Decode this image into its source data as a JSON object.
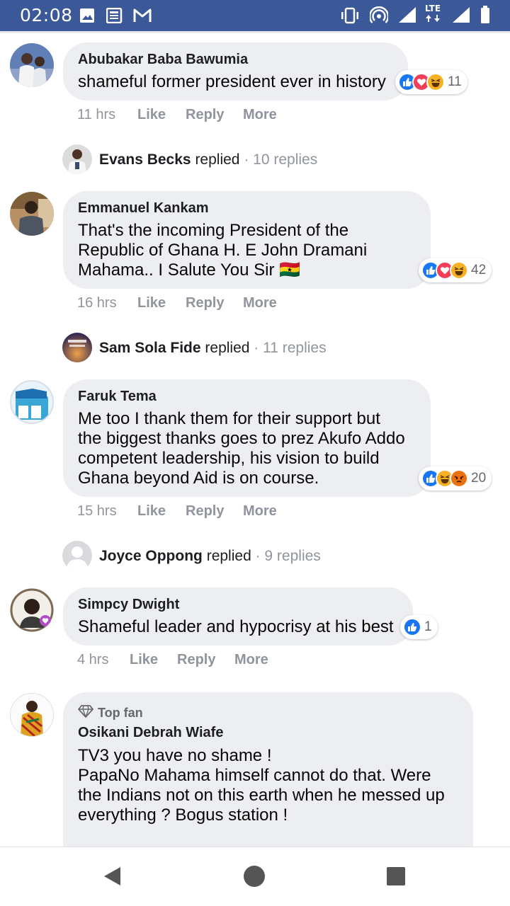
{
  "status_bar": {
    "time": "02:08",
    "left_icons": [
      "image-icon",
      "news-icon",
      "gmail-icon"
    ],
    "right_icons": [
      "vibrate-icon",
      "hotspot-icon",
      "signal-icon",
      "lte-icon",
      "signal-icon",
      "battery-icon"
    ],
    "lte_label": "LTE"
  },
  "comments": [
    {
      "author": "Abubakar Baba Bawumia",
      "lines": [
        "shameful former president ever in history"
      ],
      "reaction_count": "11",
      "reactions": [
        "like",
        "love",
        "haha"
      ],
      "time": "11 hrs",
      "actions": [
        "Like",
        "Reply",
        "More"
      ],
      "reply_summary": {
        "name": "Evans Becks",
        "verb": "replied",
        "sep": " · ",
        "count": "10 replies"
      }
    },
    {
      "author": "Emmanuel Kankam",
      "lines": [
        "That's the incoming President of the",
        "Republic of Ghana H. E John Dramani",
        "Mahama.. I Salute You Sir 🇬🇭"
      ],
      "reaction_count": "42",
      "reactions": [
        "like",
        "love",
        "haha"
      ],
      "time": "16 hrs",
      "actions": [
        "Like",
        "Reply",
        "More"
      ],
      "reply_summary": {
        "name": "Sam Sola Fide",
        "verb": "replied",
        "sep": " · ",
        "count": "11 replies"
      }
    },
    {
      "author": "Faruk Tema",
      "lines": [
        "Me too I thank them for their support but",
        "the biggest thanks goes to prez Akufo Addo",
        "competent leadership, his vision to build",
        "Ghana beyond Aid is on course."
      ],
      "reaction_count": "20",
      "reactions": [
        "like",
        "haha",
        "angry"
      ],
      "time": "15 hrs",
      "actions": [
        "Like",
        "Reply",
        "More"
      ],
      "reply_summary": {
        "name": "Joyce Oppong",
        "verb": "replied",
        "sep": " · ",
        "count": "9 replies"
      }
    },
    {
      "author": "Simpcy Dwight",
      "lines": [
        "Shameful leader and hypocrisy at his best"
      ],
      "reaction_count": "1",
      "reactions": [
        "like"
      ],
      "time": "4 hrs",
      "actions": [
        "Like",
        "Reply",
        "More"
      ]
    },
    {
      "badge": "Top fan",
      "author": "Osikani Debrah Wiafe",
      "lines": [
        "TV3 you have no shame !",
        "PapaNo Mahama himself cannot do that. Were",
        "the Indians not on this earth when he messed up",
        "everything ? Bogus station !"
      ]
    }
  ],
  "colors": {
    "status_bar": "#3b5998",
    "bubble": "#edeef1",
    "meta_grey": "#90949c",
    "like_blue": "#1877f2",
    "love_red": "#f33e58",
    "haha_yellow": "#f7b125",
    "angry_orange": "#e9710f"
  },
  "nav_bar": {
    "buttons": [
      "back-icon",
      "home-icon",
      "recents-icon"
    ]
  }
}
